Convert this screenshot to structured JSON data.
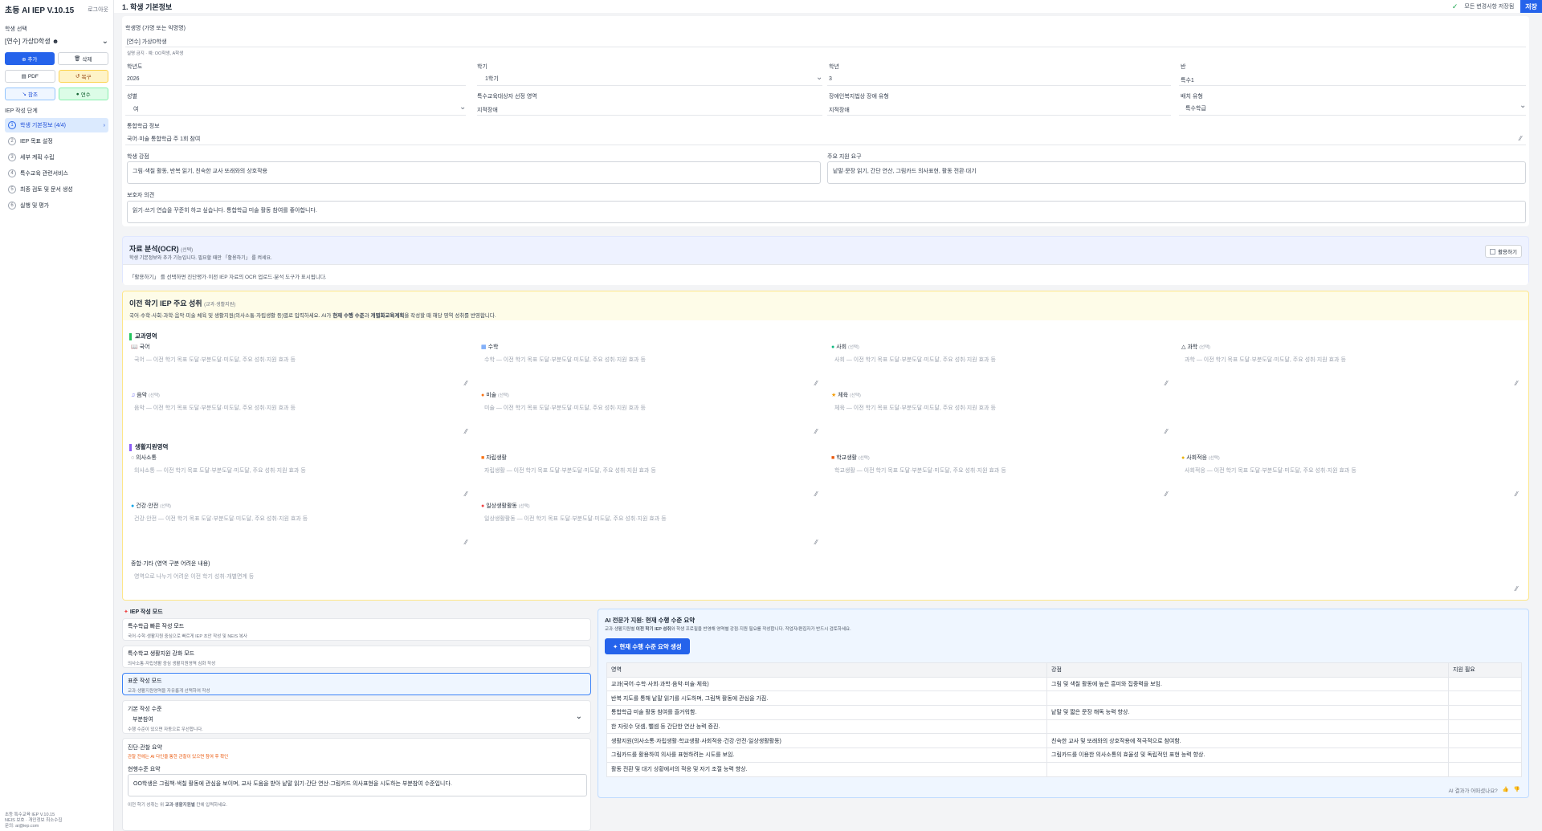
{
  "app": {
    "title": "초등 AI IEP V.10.15",
    "logout": "로그아웃"
  },
  "sidebar": {
    "student_label": "학생 선택",
    "student_value": "[연수] 가상D학생 ☻",
    "buttons": {
      "add": "⊕ 추가",
      "del": "삭제",
      "pdf": "PDF",
      "recover": "복구",
      "support": "참조",
      "training": "연수"
    },
    "steps_label": "IEP 작성 단계",
    "steps": [
      {
        "num": "1",
        "label": "학생 기본정보 (4/4)"
      },
      {
        "num": "2",
        "label": "IEP 목표 설정"
      },
      {
        "num": "3",
        "label": "세부 계획 수립"
      },
      {
        "num": "4",
        "label": "특수교육 관련서비스"
      },
      {
        "num": "5",
        "label": "최종 검토 및 문서 생성"
      },
      {
        "num": "6",
        "label": "실행 및 평가"
      }
    ],
    "footer": [
      "초등 특수교육 IEP V.10.15",
      "NEIS 보호 · 개인정보 최소수집",
      "문의: ai@iep.com"
    ]
  },
  "header": {
    "title": "1. 학생 기본정보",
    "status": "모든 변경사항 저장됨",
    "save": "저장"
  },
  "basic": {
    "name_label": "학생명 (가명 또는 익명명)",
    "name_value": "[연수] 가상D학생",
    "name_hint": "실명 금지 · 예: OO학생, A학생",
    "year_label": "학년도",
    "year_value": "2026",
    "semester_label": "학기",
    "semester_value": "1학기",
    "grade_label": "학년",
    "grade_value": "3",
    "class_label": "반",
    "class_value": "특수1",
    "gender_label": "성별",
    "gender_value": "여",
    "special_label": "특수교육대상자 선정 영역",
    "special_value": "지적장애",
    "disability_label": "장애인복지법상 장애 유형",
    "disability_value": "지적장애",
    "placement_label": "배치 유형",
    "placement_value": "특수학급",
    "inclusive_label": "통합학급 정보",
    "inclusive_value": "국어·미술 통합학급 주 1회 참여",
    "strength_label": "학생 강점",
    "strength_value": "그림·색칠 활동, 반복 읽기, 친숙한 교사 또래와의 상호작용",
    "needs_label": "주요 지원 요구",
    "needs_value": "낱말·문장 읽기, 간단 연산, 그림카드 의사표현, 활동 전환·대기",
    "parent_label": "보호자 의견",
    "parent_value": "읽기·쓰기 연습을 꾸준히 하고 싶습니다. 통합학급 미술 활동 참여를 좋아합니다."
  },
  "ocr": {
    "title": "자료 분석(OCR)",
    "optional": "(선택)",
    "subtitle": "학생 기본정보와 추가 기능입니다. 필요할 때만 「활용하기」 를 켜세요.",
    "toggle": "활용하기",
    "note": "「활용하기」 를 선택하면 진단평가·이전 IEP 자료의 OCR 업로드·분석 도구가 표시됩니다."
  },
  "prev": {
    "title": "이전 학기 IEP 주요 성취",
    "title_sub": "(교과·생활지원)",
    "desc_pre": "국어·수학·사회·과학·음악·미술 체육 및 생활지원(의사소통·자립생활 등)별로 입력하세요. AI가 ",
    "desc_b1": "현재 수행 수준",
    "desc_mid": "과 ",
    "desc_b2": "개별화교육계획",
    "desc_post": "을 작성할 때 해당 영역 성취를 반영합니다.",
    "subjects_heading": "교과영역",
    "subjects": [
      {
        "icon": "📖",
        "name": "국어",
        "opt": "",
        "ph": "국어 — 이전 학기 목표 도달·부분도달·미도달, 주요 성취·지원 효과 등"
      },
      {
        "icon": "▦",
        "name": "수학",
        "opt": "",
        "ph": "수학 — 이전 학기 목표 도달·부분도달·미도달, 주요 성취·지원 효과 등"
      },
      {
        "icon": "●",
        "name": "사회",
        "opt": "(선택)",
        "ph": "사회 — 이전 학기 목표 도달·부분도달·미도달, 주요 성취·지원 효과 등"
      },
      {
        "icon": "△",
        "name": "과학",
        "opt": "(선택)",
        "ph": "과학 — 이전 학기 목표 도달·부분도달·미도달, 주요 성취·지원 효과 등"
      },
      {
        "icon": "♫",
        "name": "음악",
        "opt": "(선택)",
        "ph": "음악 — 이전 학기 목표 도달·부분도달·미도달, 주요 성취·지원 효과 등"
      },
      {
        "icon": "●",
        "name": "미술",
        "opt": "(선택)",
        "ph": "미술 — 이전 학기 목표 도달·부분도달·미도달, 주요 성취·지원 효과 등"
      },
      {
        "icon": "★",
        "name": "체육",
        "opt": "(선택)",
        "ph": "체육 — 이전 학기 목표 도달·부분도달·미도달, 주요 성취·지원 효과 등"
      }
    ],
    "life_heading": "생활지원영역",
    "life": [
      {
        "icon": "◌",
        "name": "의사소통",
        "opt": "",
        "ph": "의사소통 — 이전 학기 목표 도달·부분도달·미도달, 주요 성취·지원 효과 등"
      },
      {
        "icon": "■",
        "name": "자립생활",
        "opt": "",
        "ph": "자립생활 — 이전 학기 목표 도달·부분도달·미도달, 주요 성취·지원 효과 등"
      },
      {
        "icon": "■",
        "name": "학교생활",
        "opt": "(선택)",
        "ph": "학교생활 — 이전 학기 목표 도달·부분도달·미도달, 주요 성취·지원 효과 등"
      },
      {
        "icon": "●",
        "name": "사회적응",
        "opt": "(선택)",
        "ph": "사회적응 — 이전 학기 목표 도달·부분도달·미도달, 주요 성취·지원 효과 등"
      },
      {
        "icon": "●",
        "name": "건강·안전",
        "opt": "(선택)",
        "ph": "건강·안전 — 이전 학기 목표 도달·부분도달·미도달, 주요 성취·지원 효과 등"
      },
      {
        "icon": "●",
        "name": "일상생활활동",
        "opt": "(선택)",
        "ph": "일상생활활동 — 이전 학기 목표 도달·부분도달·미도달, 주요 성취·지원 효과 등"
      }
    ],
    "overall_label": "종합·기타 (영역 구분 어려운 내용)",
    "overall_ph": "영역으로 나누기 어려운 이전 학기 성취·개별면계 등"
  },
  "modes": {
    "heading": "IEP 작성 모드",
    "items": [
      {
        "title": "특수학급 빠른 작성 모드",
        "desc": "국어·수학·생활지원 중심으로 빠르게 IEP 초안 작성 및 NEIS 복사"
      },
      {
        "title": "특수학교 생활지원 강화 모드",
        "desc": "의사소통·자립생활 중심 생활지원영역 심화 작성"
      },
      {
        "title": "표준 작성 모드",
        "desc": "교과·생활지원영역을 자유롭게 선택하여 작성"
      }
    ],
    "level_label": "기본 작성 수준",
    "level_value": "부분참여",
    "level_hint": "수행 수준이 있으면 자동으로 우선합니다.",
    "diag_label": "진단·관찰 요약",
    "diag_warn": "관찰 전에는 AI 다인을 통한 관찰이 있으면 참여 후 확인",
    "current_label": "현행수준 요약",
    "current_value": "OO학생은 그림책·색칠 활동에 관심을 보이며, 교사 도움을 받아 낱말 읽기·간단 연산·그림카드 의사표현을 시도하는 부분참여 수준입니다.",
    "current_foot_pre": "이전 학기 성취는 위 ",
    "current_foot_b": "교과·생활지원별",
    "current_foot_post": " 칸에 입력하세요."
  },
  "ai": {
    "title": "AI 전문가 지원: 현재 수행 수준 요약",
    "desc_pre": "교과·생활지원별 ",
    "desc_b": "이전 학기 IEP 성취",
    "desc_post": "와 학생 프로필을 반영해 영역별 강점·지원 필요를 작성합니다. 작업자/편집자가 반드시 검토하세요.",
    "button": "✦ 현재 수행 수준 요약 생성",
    "columns": [
      "영역",
      "강점",
      "지원 필요"
    ],
    "rows": [
      [
        "교과(국어·수학·사회·과학·음악·미술·체육)",
        "그림 및 색칠 활동에 높은 흥미와 집중력을 보임.",
        ""
      ],
      [
        "반복 지도를 통해 낱말 읽기를 시도하며, 그림책 활동에 관심을 가짐.",
        "",
        ""
      ],
      [
        "통합학급 미술 활동 참여를 즐거워함.",
        "낱말 및 짧은 문장 해독 능력 향상.",
        ""
      ],
      [
        "한 자릿수 덧셈, 뺄셈 등 간단한 연산 능력 증진.",
        "",
        ""
      ],
      [
        "생활지원(의사소통·자립생활·학교생활·사회적응·건강·안전·일상생활활동)",
        "친숙한 교사 및 또래와의 상호작용에 적극적으로 참여함.",
        ""
      ],
      [
        "그림카드를 활용하여 의사를 표현하려는 시도를 보임.",
        "그림카드를 이용한 의사소통의 효율성 및 독립적인 표현 능력 향상.",
        ""
      ],
      [
        "활동 전환 및 대기 상황에서의 적응 및 자기 조절 능력 향상.",
        "",
        ""
      ]
    ],
    "feedback": "AI 결과가 어떠셨나요?"
  }
}
